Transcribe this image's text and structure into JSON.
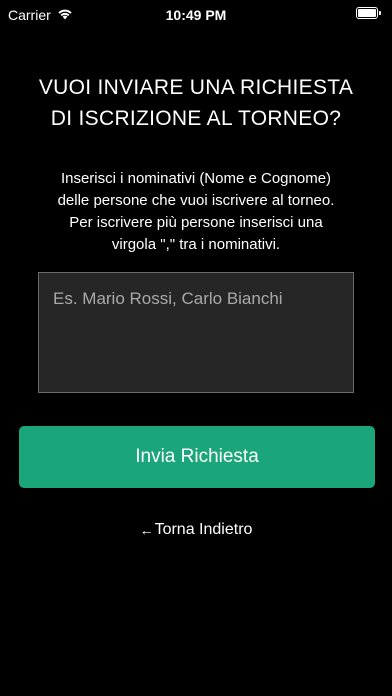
{
  "status_bar": {
    "carrier": "Carrier",
    "time": "10:49 PM"
  },
  "title": {
    "line1": "VUOI INVIARE UNA RICHIESTA",
    "line2": "DI ISCRIZIONE AL TORNEO?"
  },
  "instructions": {
    "line1": "Inserisci i nominativi (Nome e Cognome)",
    "line2": "delle persone che vuoi iscrivere al torneo.",
    "line3": "Per iscrivere più persone inserisci una",
    "line4": "virgola \",\" tra i nominativi."
  },
  "names_field": {
    "value": "",
    "placeholder": "Es. Mario Rossi, Carlo Bianchi"
  },
  "send_button": {
    "label": "Invia Richiesta",
    "color": "#1aa57a"
  },
  "back_link": {
    "arrow": "←",
    "label": "Torna Indietro"
  },
  "icons": {
    "wifi": "wifi-icon",
    "battery": "battery-icon",
    "back": "back-arrow-icon"
  },
  "colors": {
    "background": "#000000",
    "text": "#ffffff",
    "input_background": "#262626",
    "input_border": "#6a6a6a"
  }
}
